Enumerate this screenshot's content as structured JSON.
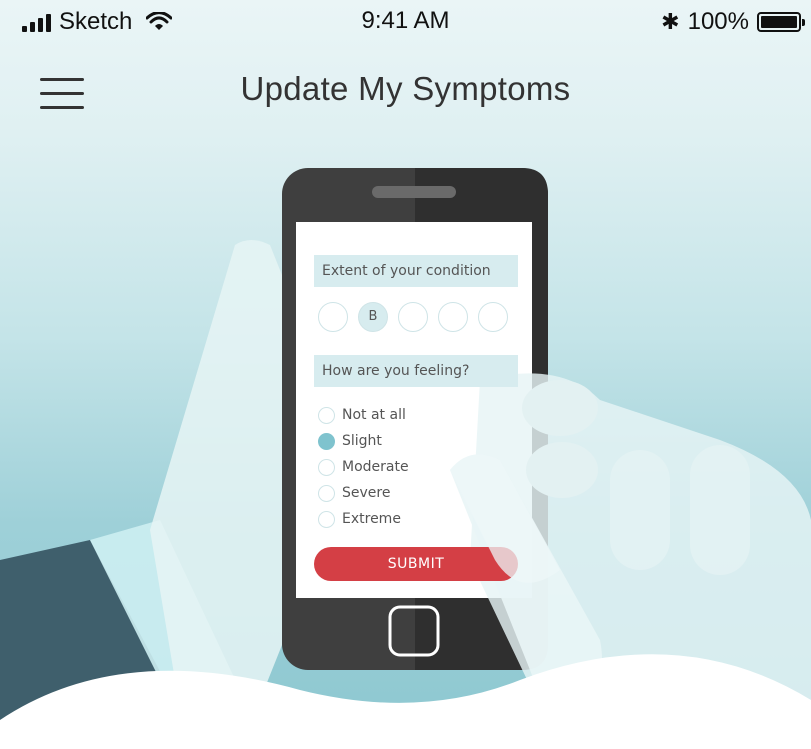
{
  "status_bar": {
    "carrier": "Sketch",
    "time": "9:41 AM",
    "battery_percent": "100%",
    "bluetooth_glyph": "✱"
  },
  "nav": {
    "title": "Update My Symptoms"
  },
  "phone_form": {
    "question1": "Extent of your condition",
    "scale_options": [
      "",
      "B",
      "",
      "",
      ""
    ],
    "scale_selected_index": 1,
    "question2": "How are you feeling?",
    "feeling_options": [
      "Not at all",
      "Slight",
      "Moderate",
      "Severe",
      "Extreme"
    ],
    "feeling_selected_index": 1,
    "submit_label": "SUBMIT"
  },
  "colors": {
    "accent_red": "#d43f45",
    "accent_teal": "#7fc3ce",
    "phone_body": "#3f3f3f"
  }
}
